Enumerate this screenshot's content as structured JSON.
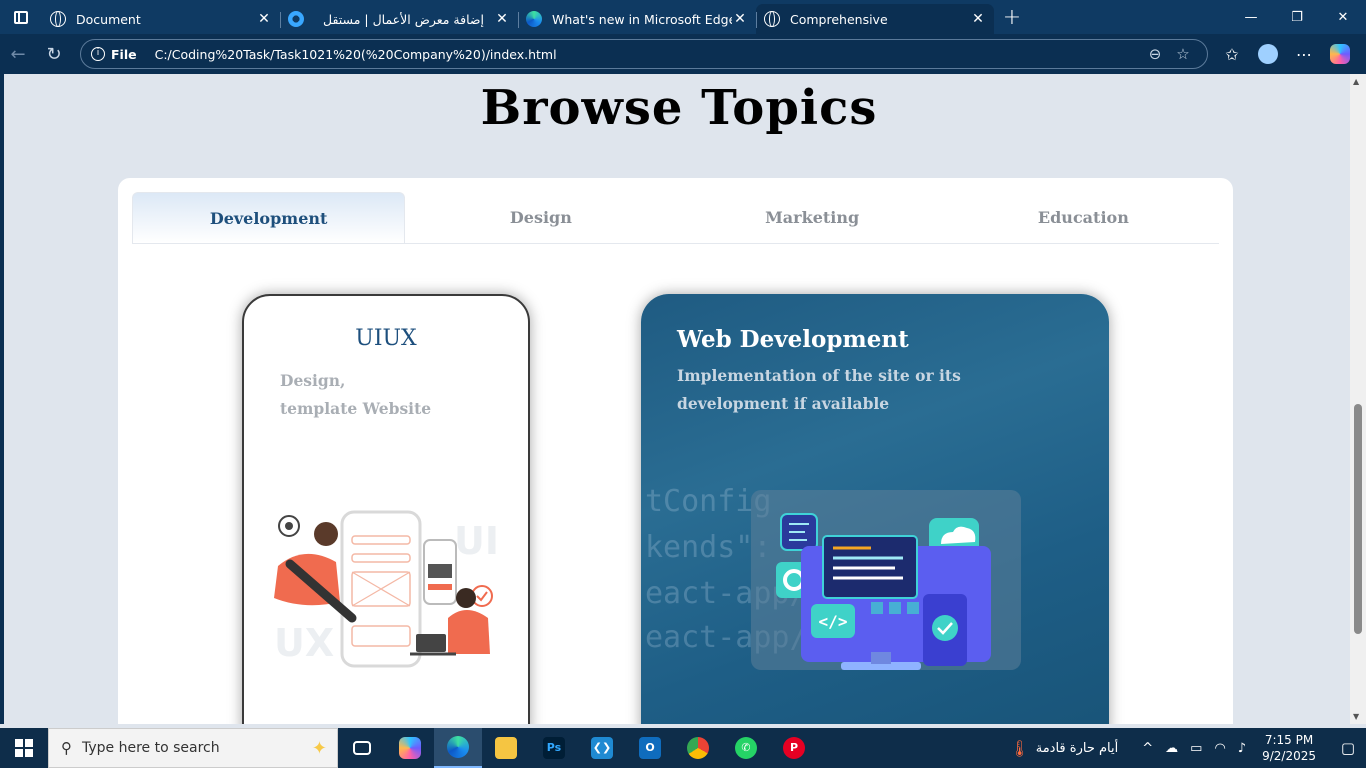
{
  "browser": {
    "tabs": [
      {
        "title": "Document",
        "icon": "globe-icon",
        "active": false
      },
      {
        "title": "إضافة معرض الأعمال | مستقل",
        "icon": "mostaql-icon",
        "active": false
      },
      {
        "title": "What's new in Microsoft Edge",
        "icon": "edge-icon",
        "active": false
      },
      {
        "title": "Comprehensive",
        "icon": "globe-icon",
        "active": true
      }
    ],
    "new_tab": "+",
    "controls": {
      "minimize": "—",
      "restore": "❐",
      "close": "✕"
    },
    "address": {
      "scheme_label": "File",
      "url": "C:/Coding%20Task/Task1021%20(%20Company%20)/index.html"
    }
  },
  "page": {
    "title": "Browse Topics",
    "tabs": [
      "Development",
      "Design",
      "Marketing",
      "Education"
    ],
    "active_tab": "Development",
    "cards": [
      {
        "title": "UIUX",
        "description_line1": "Design,",
        "description_line2": "template Website"
      },
      {
        "title": "Web Development",
        "description": "Implementation of the site or its development if available"
      }
    ]
  },
  "taskbar": {
    "search_placeholder": "Type here to search",
    "weather": "أيام حارة قادمة",
    "time": "7:15 PM",
    "date": "9/2/2025"
  },
  "colors": {
    "tabbar": "#0f3a63",
    "accent_title": "#1e4f7c",
    "card_blue": "#1f5b82"
  }
}
